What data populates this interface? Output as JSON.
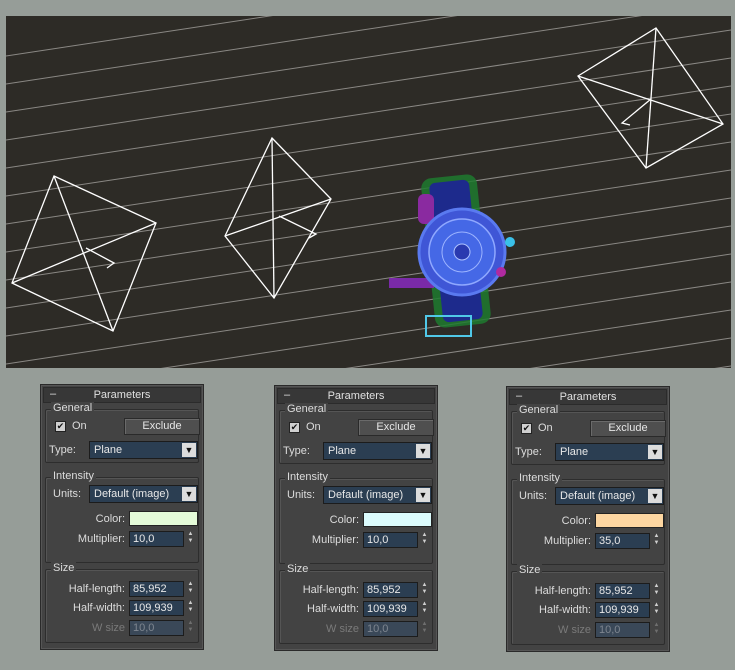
{
  "viewport": {
    "background": "#2d2b26"
  },
  "panels": [
    {
      "title": "Parameters",
      "collapse": "–",
      "general": {
        "label": "General",
        "on_checked": true,
        "on_label": "On",
        "exclude_label": "Exclude",
        "type_label": "Type:",
        "type_value": "Plane"
      },
      "intensity": {
        "label": "Intensity",
        "units_label": "Units:",
        "units_value": "Default (image)",
        "color_label": "Color:",
        "color": "#e4fbd8",
        "multiplier_label": "Multiplier:",
        "multiplier_value": "10,0"
      },
      "size": {
        "label": "Size",
        "half_length_label": "Half-length:",
        "half_length_value": "85,952",
        "half_width_label": "Half-width:",
        "half_width_value": "109,939",
        "w_size_label": "W size",
        "w_size_value": "10,0"
      }
    },
    {
      "title": "Parameters",
      "collapse": "–",
      "general": {
        "label": "General",
        "on_checked": true,
        "on_label": "On",
        "exclude_label": "Exclude",
        "type_label": "Type:",
        "type_value": "Plane"
      },
      "intensity": {
        "label": "Intensity",
        "units_label": "Units:",
        "units_value": "Default (image)",
        "color_label": "Color:",
        "color": "#dbfbfc",
        "multiplier_label": "Multiplier:",
        "multiplier_value": "10,0"
      },
      "size": {
        "label": "Size",
        "half_length_label": "Half-length:",
        "half_length_value": "85,952",
        "half_width_label": "Half-width:",
        "half_width_value": "109,939",
        "w_size_label": "W size",
        "w_size_value": "10,0"
      }
    },
    {
      "title": "Parameters",
      "collapse": "–",
      "general": {
        "label": "General",
        "on_checked": true,
        "on_label": "On",
        "exclude_label": "Exclude",
        "type_label": "Type:",
        "type_value": "Plane"
      },
      "intensity": {
        "label": "Intensity",
        "units_label": "Units:",
        "units_value": "Default (image)",
        "color_label": "Color:",
        "color": "#fdd6a1",
        "multiplier_label": "Multiplier:",
        "multiplier_value": "35,0"
      },
      "size": {
        "label": "Size",
        "half_length_label": "Half-length:",
        "half_length_value": "85,952",
        "half_width_label": "Half-width:",
        "half_width_value": "109,939",
        "w_size_label": "W size",
        "w_size_value": "10,0"
      }
    }
  ],
  "icons": {
    "check": "✔",
    "arrow": "▼",
    "spin_up": "▲",
    "spin_down": "▼"
  }
}
